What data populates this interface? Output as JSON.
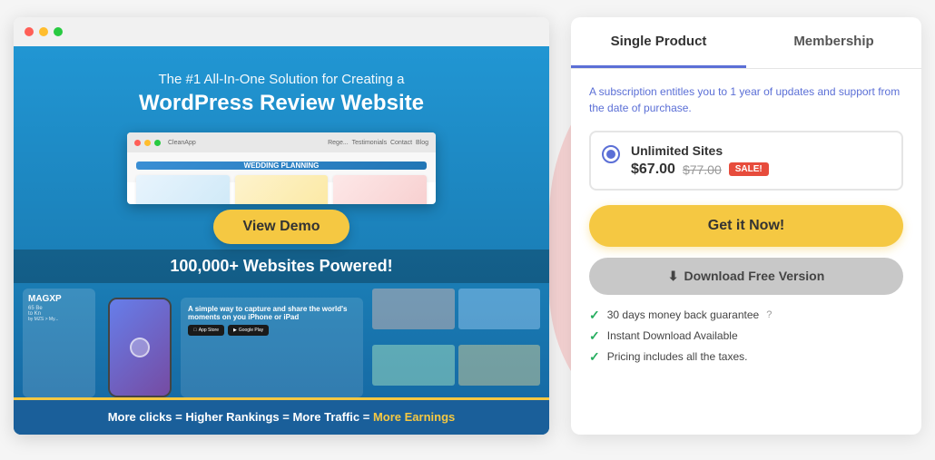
{
  "page": {
    "background": "#f0f0f0"
  },
  "browser": {
    "dots": [
      "red",
      "yellow",
      "green"
    ]
  },
  "hero": {
    "subtitle": "The #1 All-In-One Solution for Creating a",
    "title": "WordPress Review Website",
    "view_demo_label": "View Demo",
    "powered_text": "100,000+ Websites Powered!"
  },
  "bottom_banner": {
    "text": "More clicks = Higher Rankings = More Traffic = ",
    "highlight": "More Earnings"
  },
  "inner_nav": {
    "items": [
      "Rege...",
      "Testimonials",
      "Contact",
      "Blog"
    ]
  },
  "pricing": {
    "tabs": [
      {
        "id": "single",
        "label": "Single Product",
        "active": true
      },
      {
        "id": "membership",
        "label": "Membership",
        "active": false
      }
    ],
    "subscription_note": "A subscription entitles you to 1 year of updates and support from the date of purchase.",
    "option": {
      "name": "Unlimited Sites",
      "price_current": "$67.00",
      "price_old": "$77.00",
      "sale_badge": "SALE!"
    },
    "cta_label": "Get it Now!",
    "download_label": "Download Free Version",
    "guarantees": [
      {
        "text": "30 days money back guarantee",
        "has_question": true
      },
      {
        "text": "Instant Download Available",
        "has_question": false
      },
      {
        "text": "Pricing includes all the taxes.",
        "has_question": false
      }
    ]
  }
}
